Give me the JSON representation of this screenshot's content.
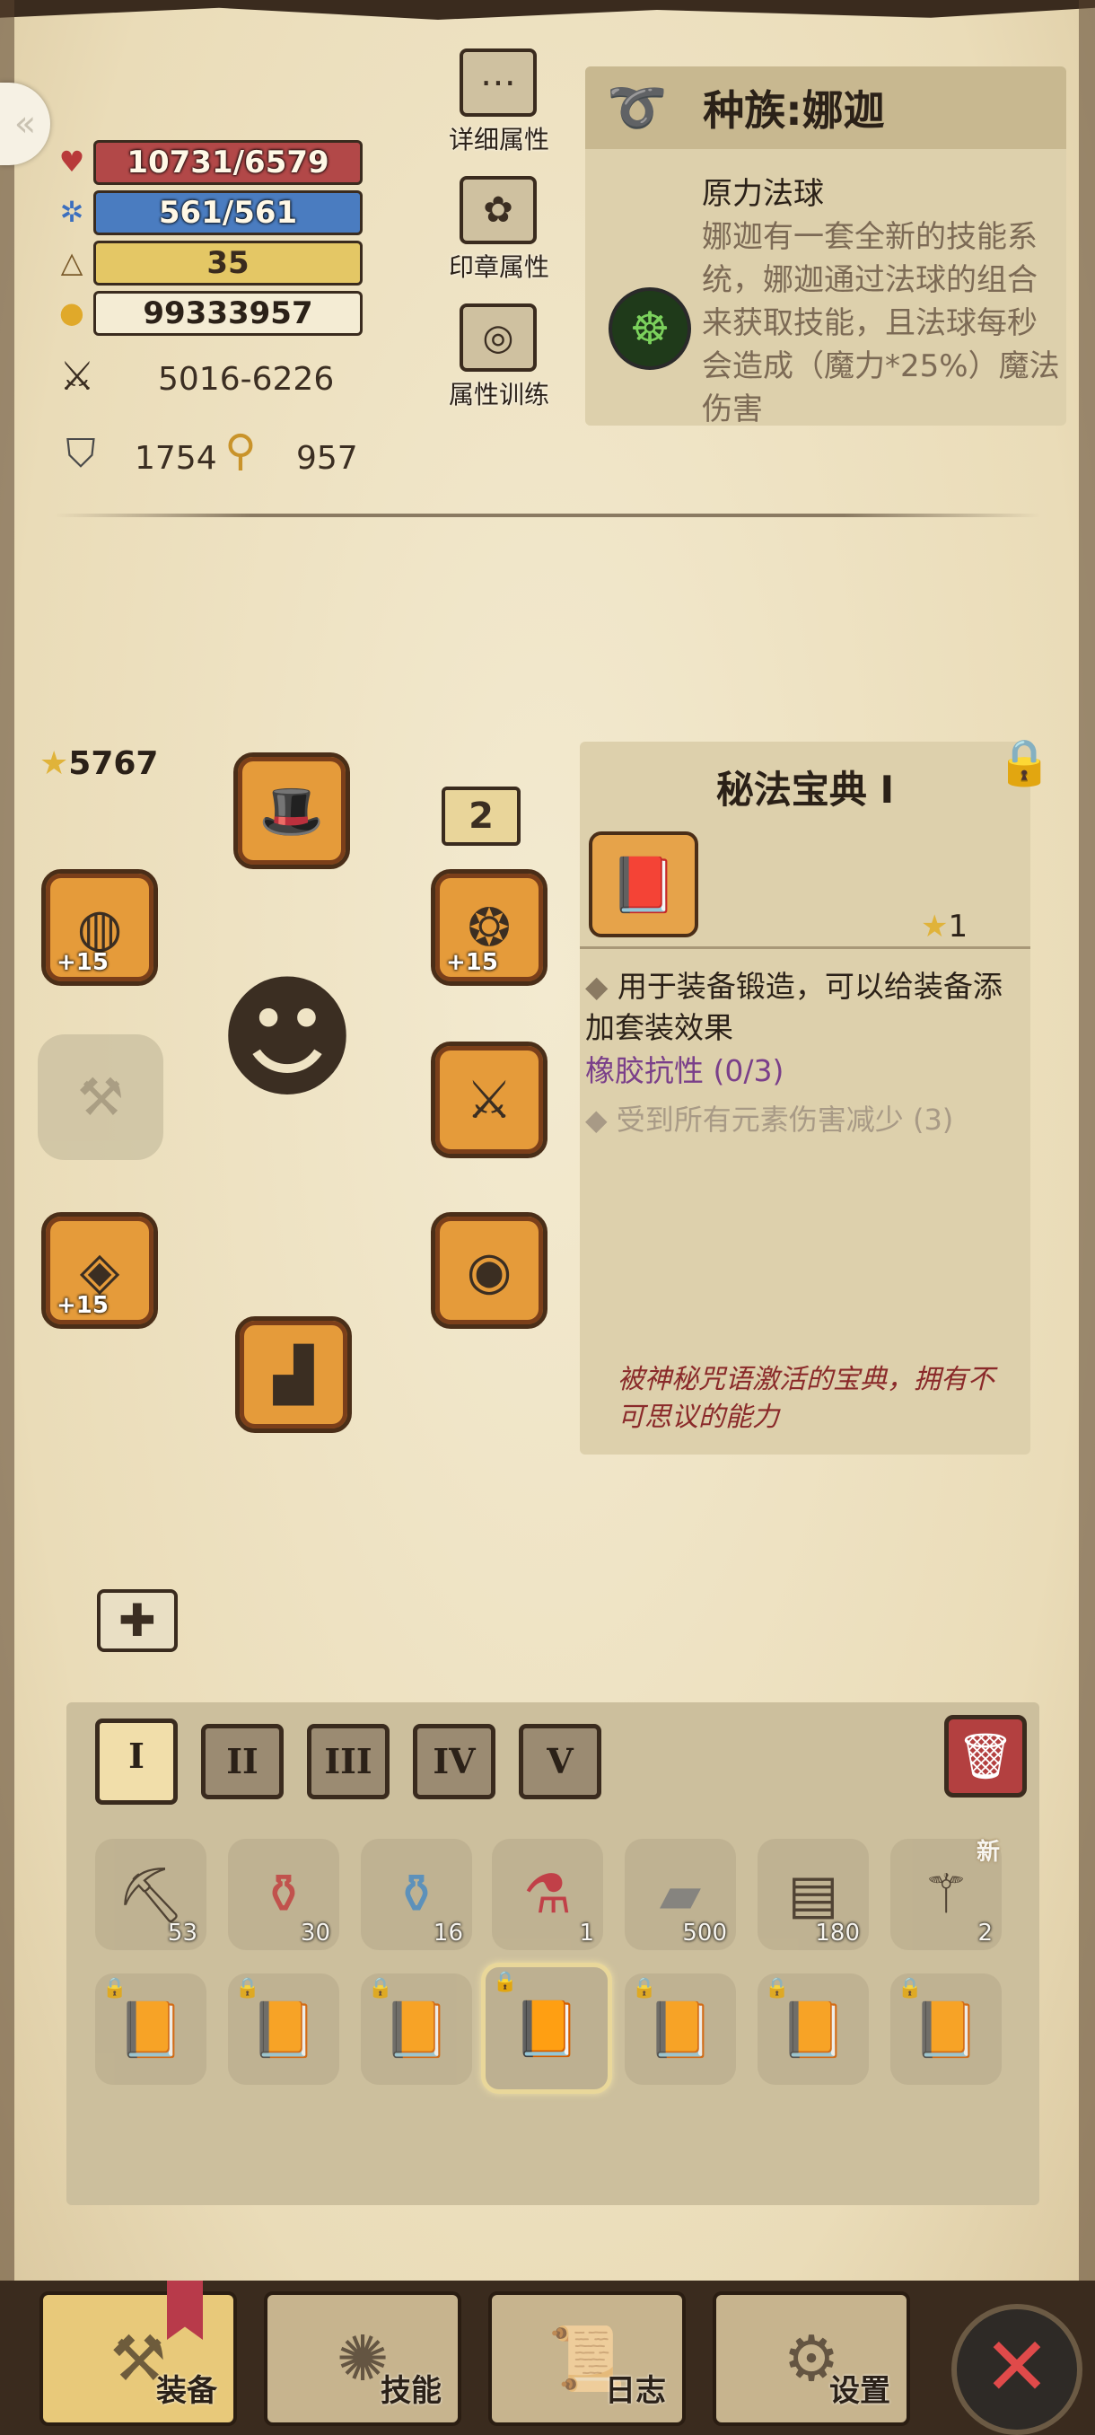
{
  "stats": {
    "hp": "10731/6579",
    "mp": "561/561",
    "level": "35",
    "gold": "99333957",
    "attack": "5016-6226",
    "defense": "1754",
    "magic": "957"
  },
  "side_buttons": {
    "detail": "详细属性",
    "seal": "印章属性",
    "training": "属性训练"
  },
  "race": {
    "title": "种族:娜迦",
    "skill_name": "原力法球",
    "description": "娜迦有一套全新的技能系统，娜迦通过法球的组合来获取技能，且法球每秒会造成（魔力*25%）魔法伤害"
  },
  "equipment": {
    "score": "5767",
    "badge": "2",
    "slots": [
      {
        "name": "helmet",
        "plus": ""
      },
      {
        "name": "left-ring",
        "plus": "+15"
      },
      {
        "name": "right-ring",
        "plus": "+15"
      },
      {
        "name": "weapon-slot",
        "plus": ""
      },
      {
        "name": "right-weapon",
        "plus": ""
      },
      {
        "name": "bracer",
        "plus": "+15"
      },
      {
        "name": "belt",
        "plus": ""
      },
      {
        "name": "boots",
        "plus": ""
      }
    ]
  },
  "item": {
    "title": "秘法宝典 I",
    "stars": "1",
    "description": "用于装备锻造，可以给装备添加套装效果",
    "set_name": "橡胶抗性 (0/3)",
    "set_effect": "受到所有元素伤害减少 (3)",
    "flavor": "被神秘咒语激活的宝典，拥有不可思议的能力"
  },
  "inventory": {
    "tabs": [
      "I",
      "II",
      "III",
      "IV",
      "V"
    ],
    "active_tab": "I",
    "row1": [
      {
        "icon": "pickaxe",
        "qty": "53"
      },
      {
        "icon": "red-potion",
        "qty": "30"
      },
      {
        "icon": "blue-potion",
        "qty": "16"
      },
      {
        "icon": "red-flask",
        "qty": "1"
      },
      {
        "icon": "iron-ingot",
        "qty": "500"
      },
      {
        "icon": "chest",
        "qty": "180"
      },
      {
        "icon": "shovel",
        "qty": "2",
        "new": "新"
      }
    ],
    "row2_count": 7
  },
  "nav": {
    "equip": "装备",
    "skills": "技能",
    "log": "日志",
    "settings": "设置"
  },
  "colors": {
    "hp": "#b24848",
    "mp": "#4a7cc0",
    "level": "#e4c765",
    "slot": "#e59b3a",
    "set_text": "#7a3f8a",
    "flavor_text": "#8a2a2a"
  }
}
